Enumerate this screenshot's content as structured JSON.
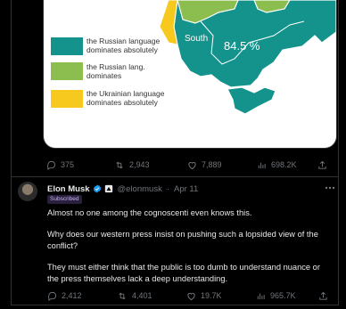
{
  "map": {
    "legend": [
      {
        "text": "the Russian language dominates absolutely",
        "color": "#13938c"
      },
      {
        "text": "the Russian lang. dominates",
        "color": "#8bbd4f"
      },
      {
        "text": "the Ukrainian language dominates  absolutely",
        "color": "#f7c91e"
      }
    ],
    "region_name": "South",
    "region_percent": "84.5 %"
  },
  "top_actions": {
    "replies": "375",
    "retweets": "2,943",
    "likes": "7,889",
    "views": "698.2K"
  },
  "tweet": {
    "name": "Elon Musk",
    "handle": "@elonmusk",
    "separator": "·",
    "date": "Apr 11",
    "badge": "Subscribed",
    "more_icon": "more-horizontal-icon",
    "paragraphs": [
      "Almost no one among the cognoscenti even knows this.",
      "Why does our western press insist on pushing such a lopsided view of the conflict?",
      "They must either think that the public is too dumb to understand nuance or the press themselves lack a deep understanding."
    ],
    "actions": {
      "replies": "2,412",
      "retweets": "4,401",
      "likes": "19.7K",
      "views": "965.7K"
    }
  },
  "colors": {
    "background": "#000000",
    "text": "#e7e9ea",
    "muted": "#71767b",
    "verified": "#1d9bf0"
  }
}
